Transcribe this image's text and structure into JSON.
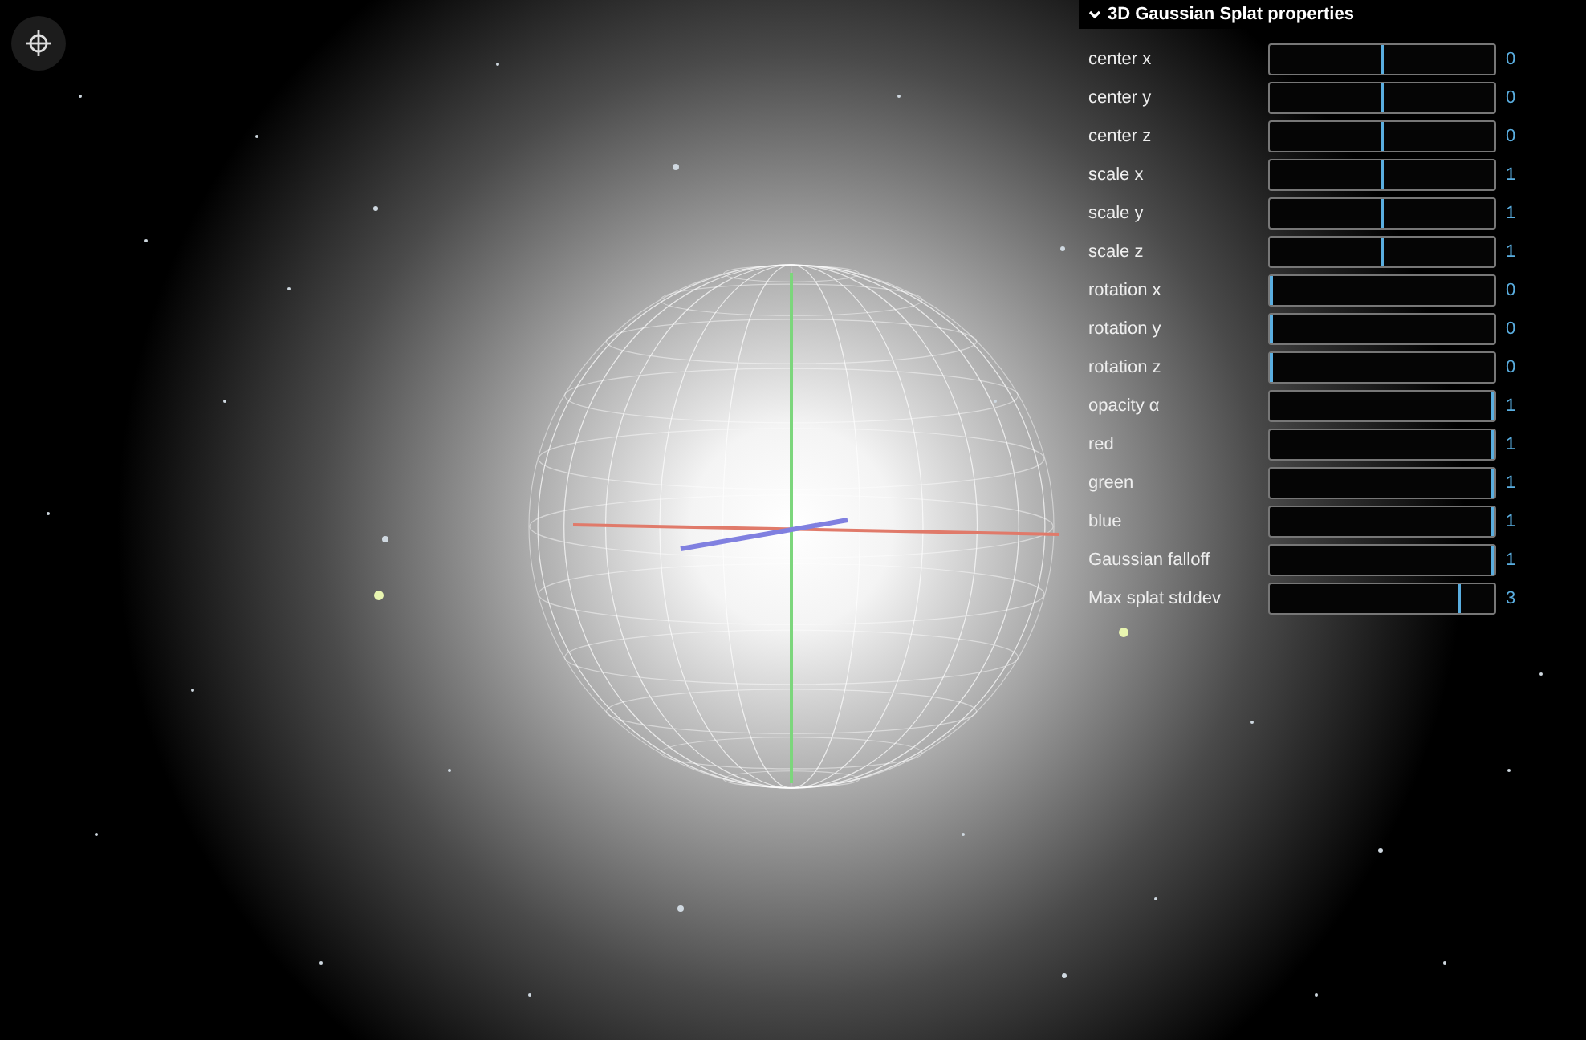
{
  "panel": {
    "title": "3D Gaussian Splat properties",
    "expanded": true,
    "controls": [
      {
        "label": "center x",
        "level": 0.5,
        "reading": "0"
      },
      {
        "label": "center y",
        "level": 0.5,
        "reading": "0"
      },
      {
        "label": "center z",
        "level": 0.5,
        "reading": "0"
      },
      {
        "label": "scale x",
        "level": 0.5,
        "reading": "1"
      },
      {
        "label": "scale y",
        "level": 0.5,
        "reading": "1"
      },
      {
        "label": "scale z",
        "level": 0.5,
        "reading": "1"
      },
      {
        "label": "rotation x",
        "level": 0,
        "reading": "0"
      },
      {
        "label": "rotation y",
        "level": 0,
        "reading": "0"
      },
      {
        "label": "rotation z",
        "level": 0,
        "reading": "0"
      },
      {
        "label": "opacity α",
        "level": 1,
        "reading": "1"
      },
      {
        "label": "red",
        "level": 1,
        "reading": "1"
      },
      {
        "label": "green",
        "level": 1,
        "reading": "1"
      },
      {
        "label": "blue",
        "level": 1,
        "reading": "1"
      },
      {
        "label": "Gaussian falloff",
        "level": 1,
        "reading": "1"
      },
      {
        "label": "Max splat stddev",
        "level": 0.85,
        "reading": "3"
      }
    ]
  }
}
